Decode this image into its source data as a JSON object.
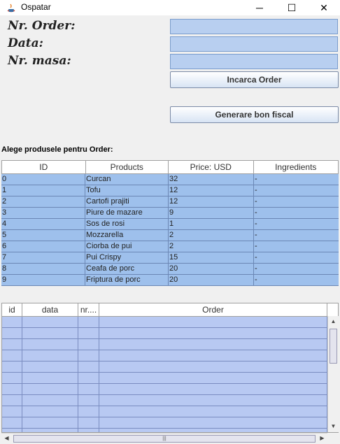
{
  "window": {
    "title": "Ospatar",
    "minimize": "─",
    "maximize": "☐",
    "close": "✕"
  },
  "form": {
    "order_label": "Nr. Order:",
    "date_label": "Data:",
    "table_label": "Nr. masa:",
    "order_value": "",
    "date_value": "",
    "table_value": "",
    "load_button": "Incarca Order",
    "receipt_button": "Generare bon fiscal"
  },
  "products": {
    "section_label": "Alege produsele pentru Order:",
    "columns": [
      "ID",
      "Products",
      "Price: USD",
      "Ingredients"
    ],
    "rows": [
      [
        "0",
        "Curcan",
        "32",
        "-"
      ],
      [
        "1",
        "Tofu",
        "12",
        "-"
      ],
      [
        "2",
        "Cartofi prajiti",
        "12",
        "-"
      ],
      [
        "3",
        "Piure de mazare",
        "9",
        "-"
      ],
      [
        "4",
        "Sos de rosi",
        "1",
        "-"
      ],
      [
        "5",
        "Mozzarella",
        "2",
        "-"
      ],
      [
        "6",
        "Ciorba de pui",
        "2",
        "-"
      ],
      [
        "7",
        "Pui Crispy",
        "15",
        "-"
      ],
      [
        "8",
        "Ceafa de porc",
        "20",
        "-"
      ],
      [
        "9",
        "Friptura de porc",
        "20",
        "-"
      ]
    ]
  },
  "orders": {
    "columns": [
      "id",
      "data",
      "nr....",
      "Order"
    ]
  },
  "colors": {
    "accent": "#9ec0ec",
    "order_rows": "#b8c9f2",
    "input": "#b8cff0"
  }
}
